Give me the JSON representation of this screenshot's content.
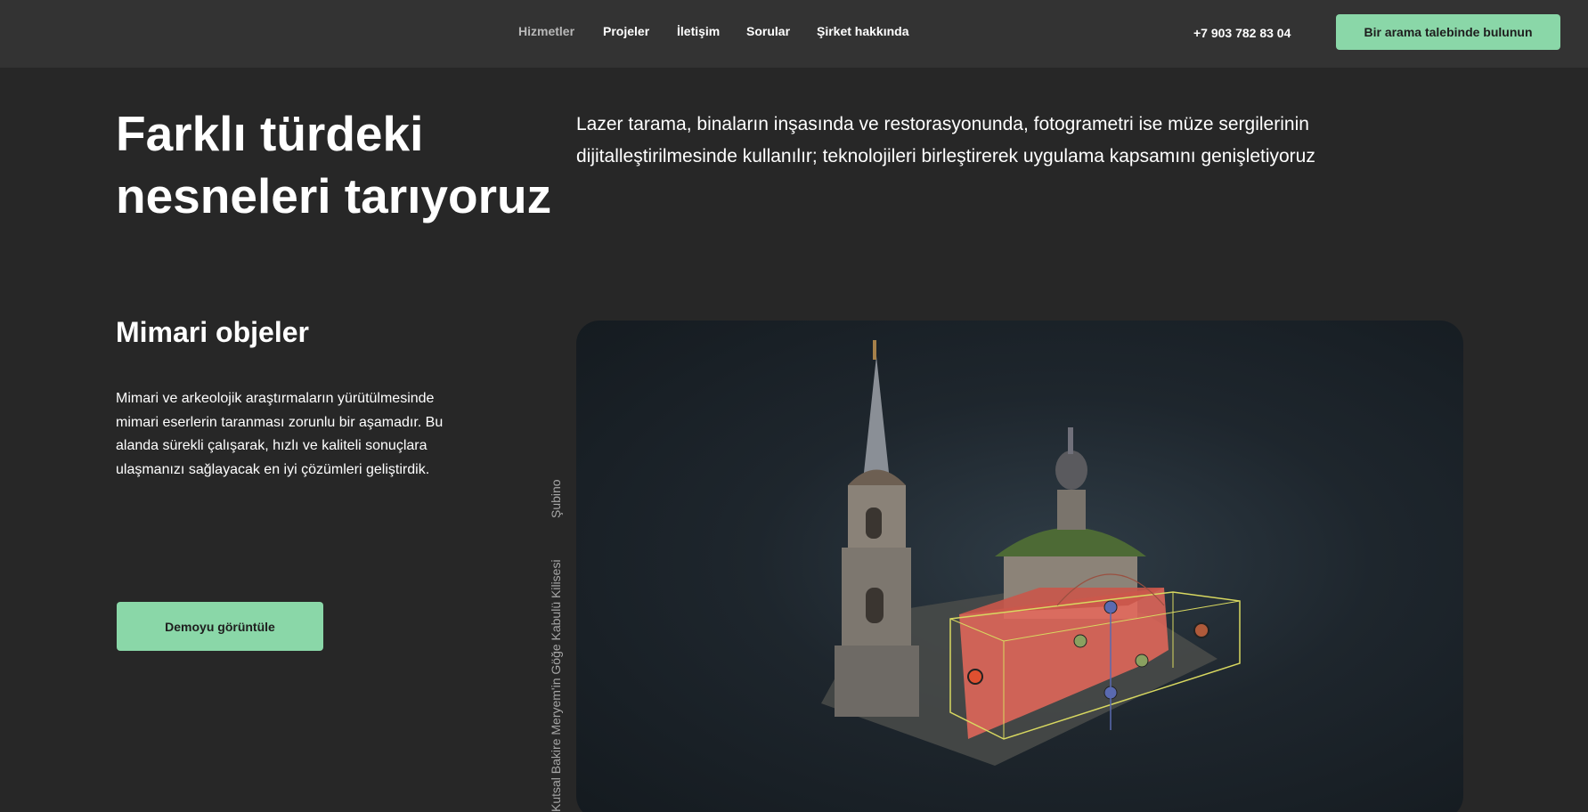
{
  "header": {
    "nav": [
      {
        "label": "Hizmetler",
        "active": true
      },
      {
        "label": "Projeler",
        "active": false
      },
      {
        "label": "İletişim",
        "active": false
      },
      {
        "label": "Sorular",
        "active": false
      },
      {
        "label": "Şirket hakkında",
        "active": false
      }
    ],
    "phone": "+7 903 782 83 04",
    "cta_label": "Bir arama talebinde bulunun"
  },
  "hero": {
    "title": "Farklı türdeki nesneleri tarıyoruz",
    "text": "Lazer tarama, binaların inşasında ve restorasyonunda, fotogrametri ise müze sergilerinin dijitalleştirilmesinde kullanılır; teknolojileri birleştirerek uygulama kapsamını genişletiyoruz"
  },
  "section": {
    "title": "Mimari objeler",
    "text": "Mimari ve arkeolojik araştırmaların yürütülmesinde mimari eserlerin taranması zorunlu bir aşamadır. Bu alanda sürekli çalışarak, hızlı ve kaliteli sonuçlara ulaşmanızı sağlayacak en iyi çözümleri geliştirdik.",
    "demo_label": "Demoyu görüntüle",
    "location_label": "Şubino",
    "object_label": "Kutsal Bakire Meryem'in Göğe Kabulü Kilisesi"
  },
  "viewer": {
    "image": "3d-church-model",
    "colors": {
      "accent": "#8ad7a8",
      "highlight": "#e8695a",
      "bbox": "#d8d860"
    }
  }
}
